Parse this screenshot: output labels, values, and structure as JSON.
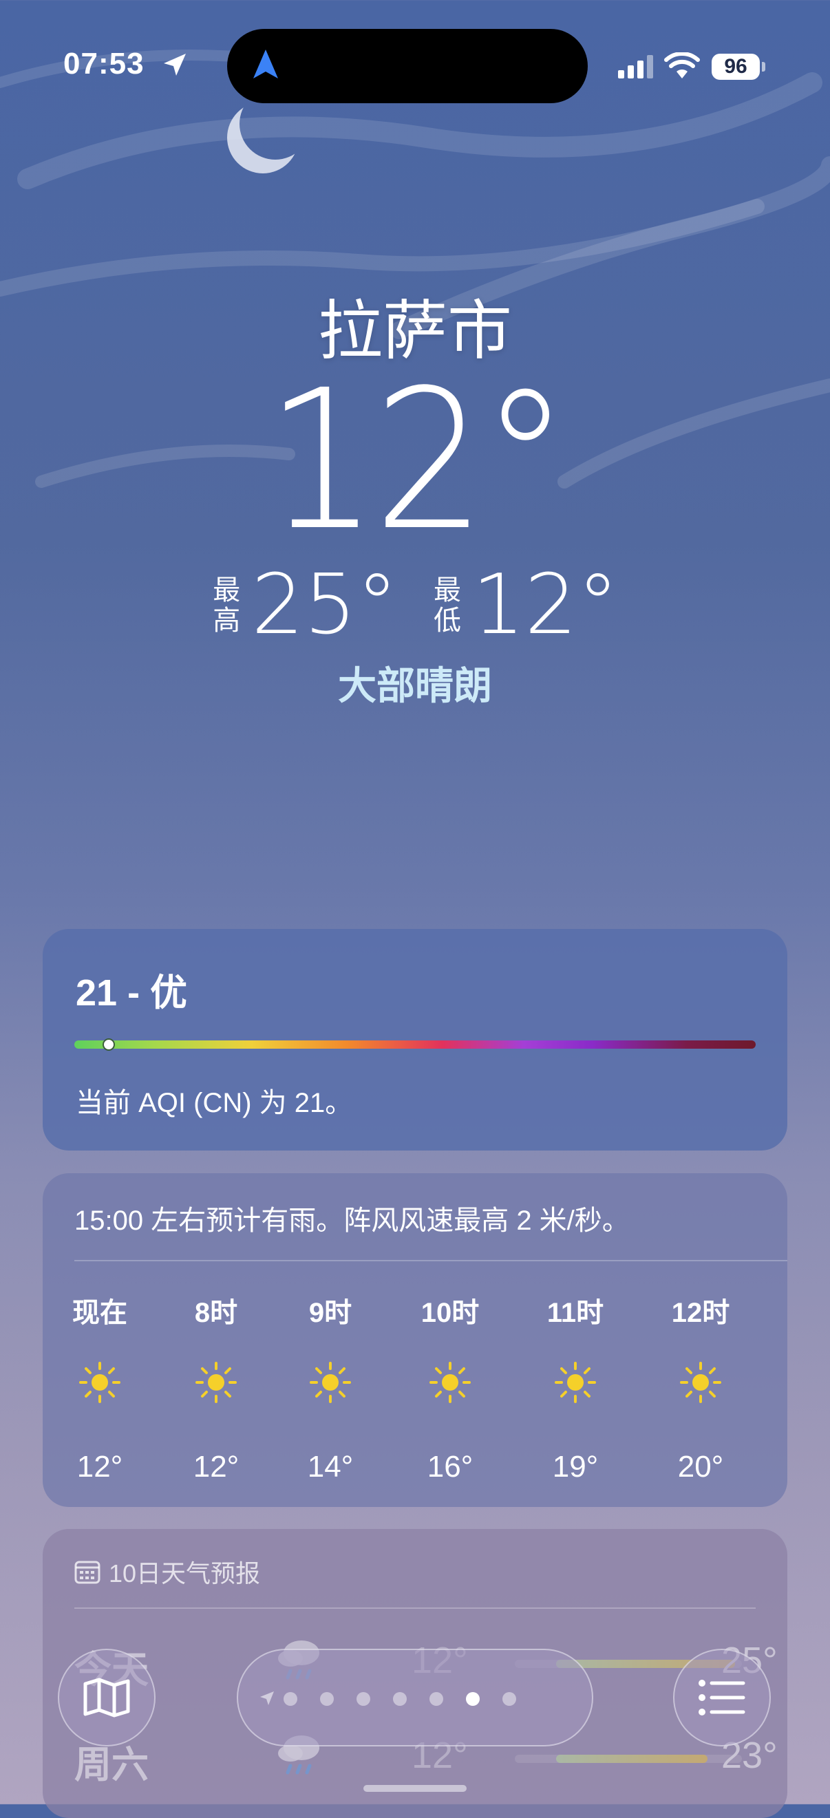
{
  "status_bar": {
    "time": "07:53",
    "battery": "96"
  },
  "location": {
    "city": "拉萨市"
  },
  "current": {
    "temperature": "12°",
    "high_label": "最\n高",
    "high": "25°",
    "low_label": "最\n低",
    "low": "12°",
    "condition": "大部晴朗"
  },
  "aqi": {
    "title": "21 - 优",
    "value": 21,
    "description": "当前 AQI (CN) 为 21。"
  },
  "hourly": {
    "message": "15:00 左右预计有雨。阵风风速最高 2 米/秒。",
    "items": [
      {
        "label": "现在",
        "icon": "sun-icon",
        "temp": "12°"
      },
      {
        "label": "8时",
        "icon": "sun-icon",
        "temp": "12°"
      },
      {
        "label": "9时",
        "icon": "sun-icon",
        "temp": "14°"
      },
      {
        "label": "10时",
        "icon": "sun-icon",
        "temp": "16°"
      },
      {
        "label": "11时",
        "icon": "sun-icon",
        "temp": "19°"
      },
      {
        "label": "12时",
        "icon": "sun-icon",
        "temp": "20°"
      }
    ]
  },
  "daily": {
    "header": "10日天气预报",
    "rows": [
      {
        "day": "今天",
        "icon": "rain-cloud-icon",
        "low": "12°",
        "high": "25°"
      },
      {
        "day": "周六",
        "icon": "rain-cloud-icon",
        "low": "12°",
        "high": "23°"
      }
    ]
  },
  "pager": {
    "count": 8,
    "active_index": 6
  },
  "colors": {
    "sun": "#f5d02a",
    "condition_text": "#cdeaf8"
  }
}
